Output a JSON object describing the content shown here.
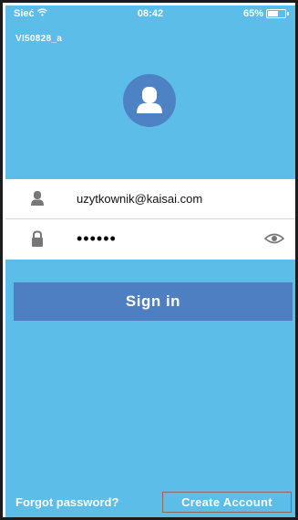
{
  "status_bar": {
    "carrier": "Sieć",
    "time": "08:42",
    "battery": "65%",
    "battery_level": 0.65,
    "wifi_icon": "wifi-icon",
    "battery_icon": "battery-icon"
  },
  "device": {
    "name": "VI50828_a"
  },
  "avatar": {
    "icon": "user-avatar-icon",
    "color": "#4d83c4"
  },
  "login": {
    "username_icon": "user-icon",
    "username_value": "uzytkownik@kaisai.com",
    "password_icon": "lock-icon",
    "password_value": "••••••",
    "reveal_icon": "eye-icon"
  },
  "buttons": {
    "sign_in": "Sign in",
    "forgot_password": "Forgot password?",
    "create_account": "Create Account"
  },
  "colors": {
    "background": "#5cbde9",
    "button": "#4d7fc2",
    "create_account_border": "#8b6b56"
  }
}
